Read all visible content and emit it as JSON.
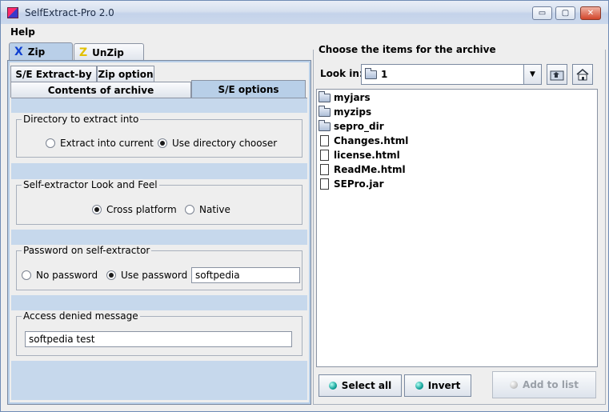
{
  "window": {
    "title": "SelfExtract-Pro 2.0",
    "minimize": "▭",
    "maximize": "▢",
    "close": "✕"
  },
  "menu": {
    "help": "Help"
  },
  "main_tabs": {
    "zip": "Zip",
    "unzip": "UnZip"
  },
  "sub_tabs": {
    "se_extract_by": "S/E Extract-by",
    "zip_option": "Zip option",
    "contents": "Contents of archive",
    "se_options": "S/E options"
  },
  "directory_group": {
    "title": "Directory to extract into",
    "option1": "Extract into current",
    "option2": "Use directory chooser",
    "selected": "option2"
  },
  "lookfeel_group": {
    "title": "Self-extractor Look and Feel",
    "option1": "Cross platform",
    "option2": "Native",
    "selected": "option1"
  },
  "password_group": {
    "title": "Password on self-extractor",
    "option1": "No password",
    "option2": "Use password",
    "selected": "option2",
    "value": "softpedia"
  },
  "access_group": {
    "title": "Access denied message",
    "value": "softpedia test"
  },
  "right_panel": {
    "title": "Choose the items for the archive",
    "look_in_label": "Look in:",
    "look_in_value": "1",
    "files": [
      {
        "name": "myjars",
        "type": "folder"
      },
      {
        "name": "myzips",
        "type": "folder"
      },
      {
        "name": "sepro_dir",
        "type": "folder"
      },
      {
        "name": "Changes.html",
        "type": "file"
      },
      {
        "name": "license.html",
        "type": "file"
      },
      {
        "name": "ReadMe.html",
        "type": "file"
      },
      {
        "name": "SEPro.jar",
        "type": "file"
      }
    ],
    "select_all": "Select all",
    "invert": "Invert",
    "add_to_list": "Add to list"
  }
}
